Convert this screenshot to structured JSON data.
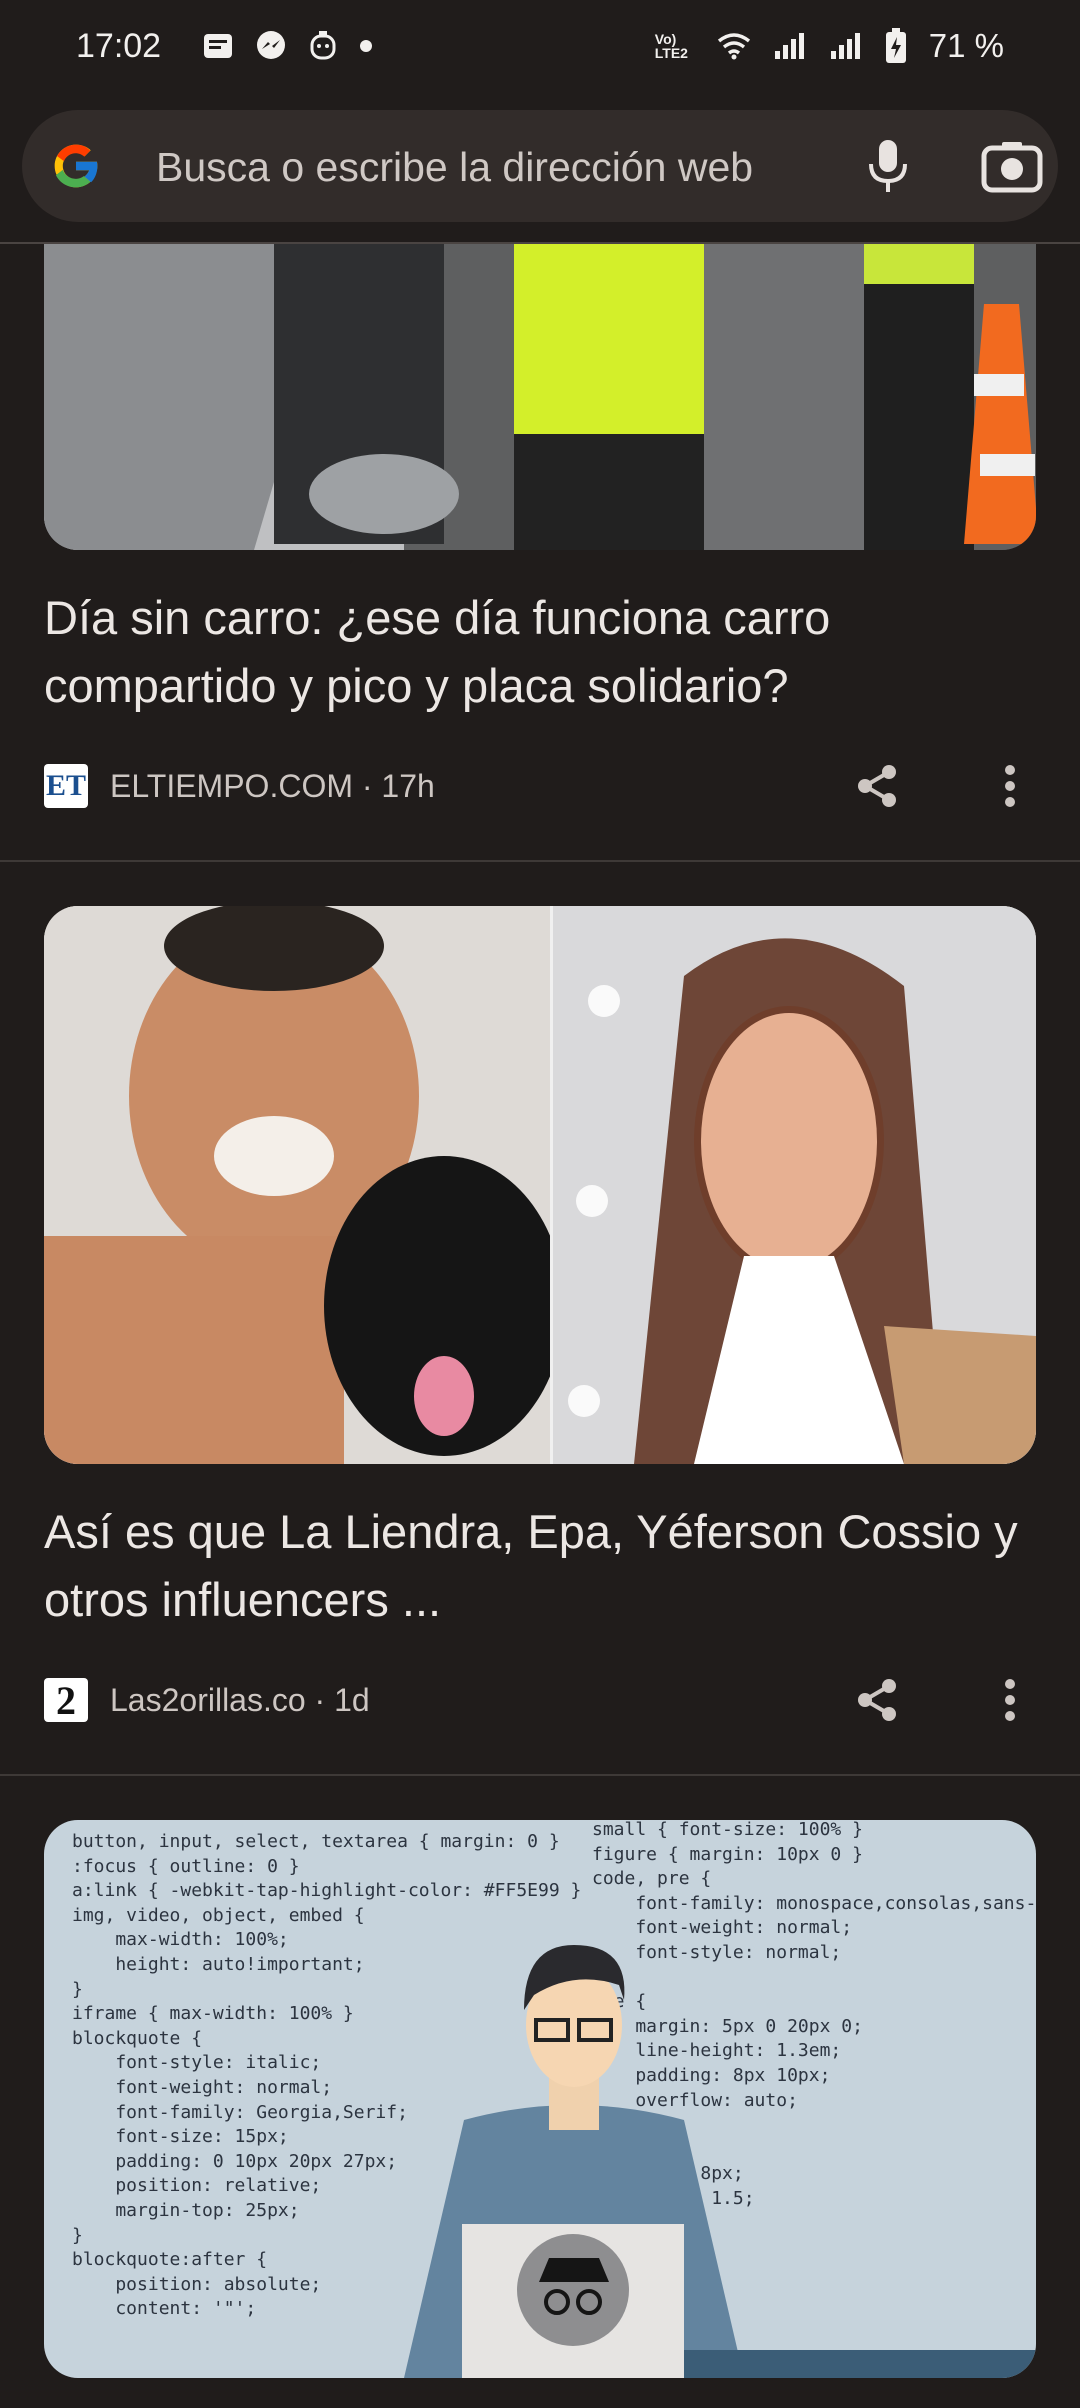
{
  "status_bar": {
    "time": "17:02",
    "battery_percent": "71 %",
    "network_label": "Vo) LTE2",
    "icons": [
      "notes-icon",
      "messenger-icon",
      "assistant-icon",
      "dot-icon",
      "wifi-icon",
      "signal-icon",
      "signal-icon",
      "battery-icon"
    ]
  },
  "search": {
    "placeholder": "Busca o escribe la dirección web",
    "mic_icon": "mic-icon",
    "camera_icon": "lens-camera-icon"
  },
  "feed": [
    {
      "title": "Día sin carro: ¿ese día funciona carro compartido y pico y placa solidario?",
      "source": "ELTIEMPO.COM",
      "time": "17h",
      "logo_text": "ET",
      "image_desc_icon": "traffic-police-photo"
    },
    {
      "title": "Así es que La Liendra, Epa, Yéferson Cossio y otros influencers ...",
      "source": "Las2orillas.co",
      "time": "1d",
      "logo_text": "2"
    },
    {
      "code_left": "button, input, select, textarea { margin: 0 }\n:focus { outline: 0 }\na:link { -webkit-tap-highlight-color: #FF5E99 }\nimg, video, object, embed {\n    max-width: 100%;\n    height: auto!important;\n}\niframe { max-width: 100% }\nblockquote {\n    font-style: italic;\n    font-weight: normal;\n    font-family: Georgia,Serif;\n    font-size: 15px;\n    padding: 0 10px 20px 27px;\n    position: relative;\n    margin-top: 25px;\n}\nblockquote:after {\n    position: absolute;\n    content: '\"';",
      "code_right": "small { font-size: 100% }\nfigure { margin: 10px 0 }\ncode, pre {\n    font-family: monospace,consolas,sans-\n    font-weight: normal;\n    font-style: normal;\n}\npre {\n    margin: 5px 0 20px 0;\n    line-height: 1.3em;\n    padding: 8px 10px;\n    overflow: auto;\n\n{\n    ng: 0 8px;\n    eight: 1.5;\n\n\n    1px 6px;\n    0 2px;\n    black;"
    }
  ]
}
